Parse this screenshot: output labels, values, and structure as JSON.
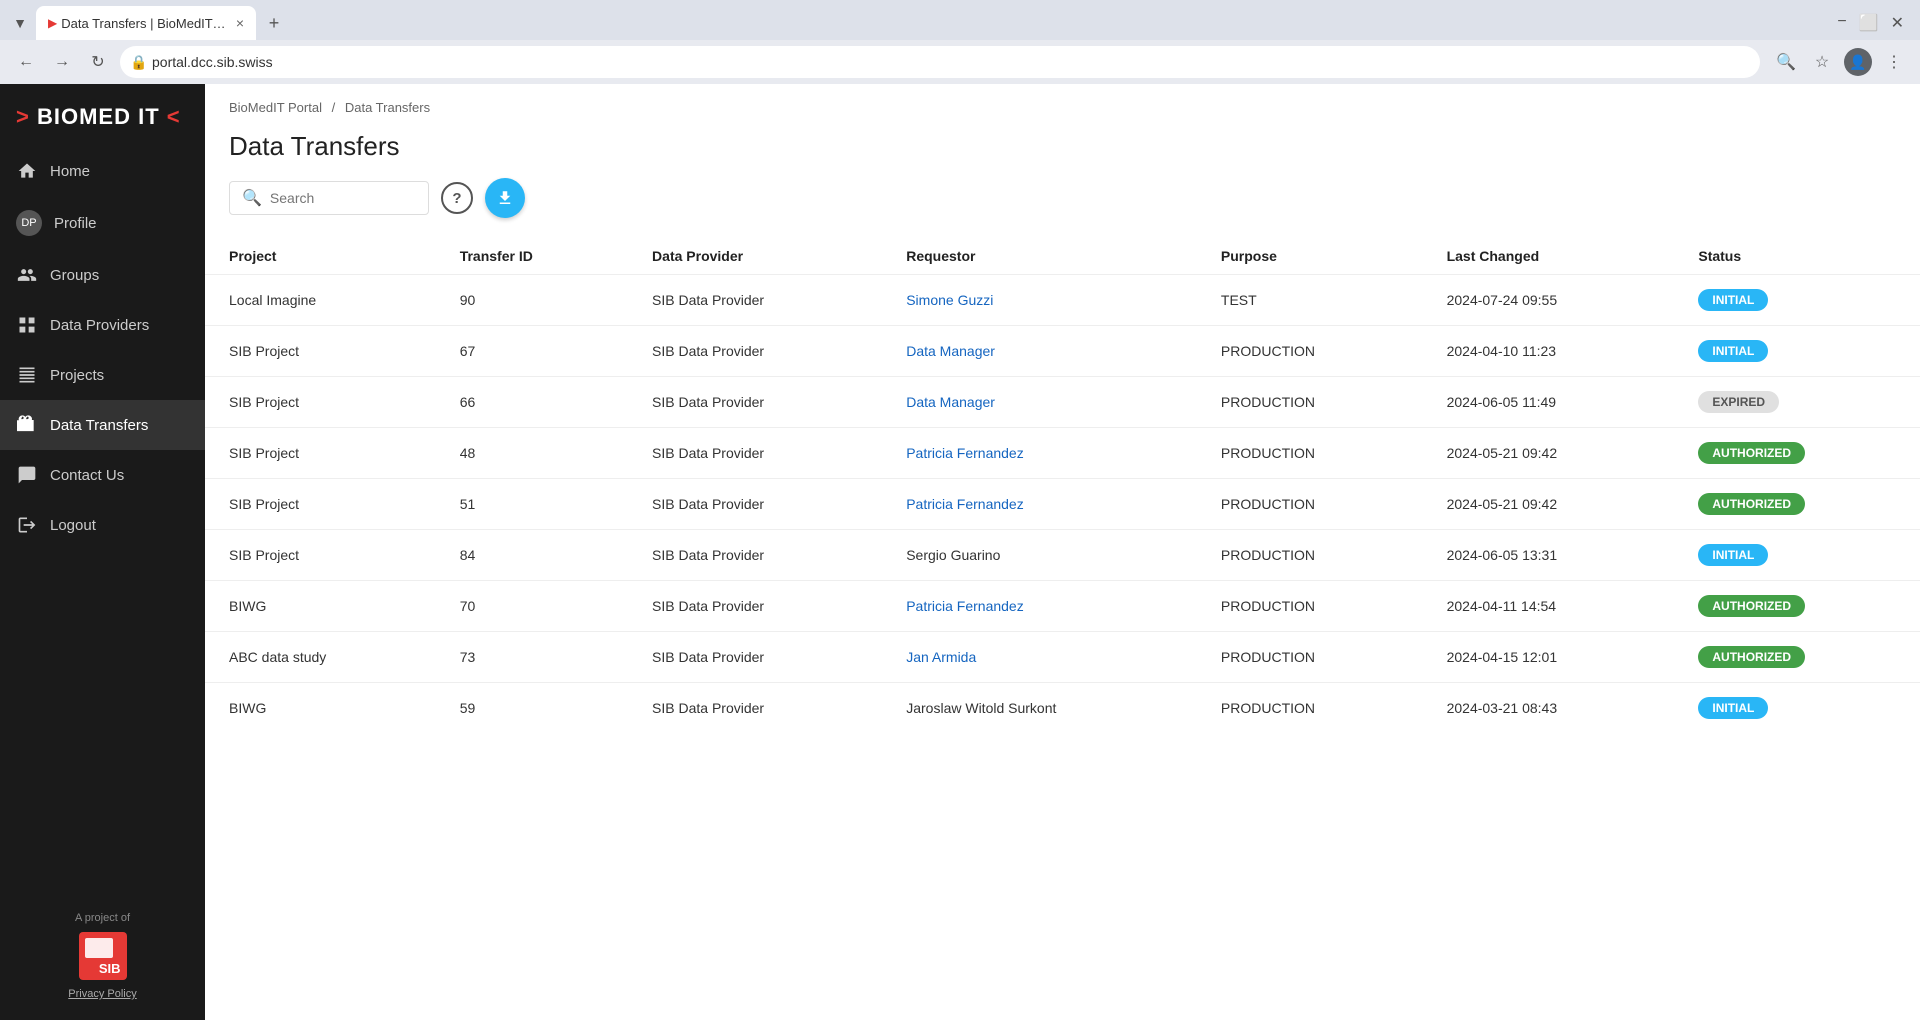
{
  "browser": {
    "tab_title": "Data Transfers | BioMedIT Porta",
    "url": "portal.dcc.sib.swiss",
    "new_tab_label": "+",
    "close_tab": "×",
    "minimize": "−",
    "maximize": "⬜",
    "close_window": "✕"
  },
  "sidebar": {
    "logo_main": "BIOMED IT",
    "nav_items": [
      {
        "id": "home",
        "label": "Home",
        "icon": "home"
      },
      {
        "id": "profile",
        "label": "Profile",
        "icon": "avatar",
        "avatar_text": "DP"
      },
      {
        "id": "groups",
        "label": "Groups",
        "icon": "people"
      },
      {
        "id": "data-providers",
        "label": "Data Providers",
        "icon": "grid"
      },
      {
        "id": "projects",
        "label": "Projects",
        "icon": "table"
      },
      {
        "id": "data-transfers",
        "label": "Data Transfers",
        "icon": "briefcase",
        "active": true
      },
      {
        "id": "contact-us",
        "label": "Contact Us",
        "icon": "chat"
      },
      {
        "id": "logout",
        "label": "Logout",
        "icon": "logout"
      }
    ],
    "footer_text": "A project of",
    "sib_logo_text": "SIB",
    "privacy_link": "Privacy Policy"
  },
  "breadcrumb": {
    "home_label": "BioMedIT Portal",
    "separator": "/",
    "current": "Data Transfers"
  },
  "page": {
    "title": "Data Transfers",
    "search_placeholder": "Search"
  },
  "table": {
    "columns": [
      "Project",
      "Transfer ID",
      "Data Provider",
      "Requestor",
      "Purpose",
      "Last Changed",
      "Status"
    ],
    "rows": [
      {
        "project": "Local Imagine",
        "transfer_id": "90",
        "data_provider": "SIB Data Provider",
        "requestor": "Simone Guzzi",
        "requestor_link": true,
        "purpose": "TEST",
        "last_changed": "2024-07-24 09:55",
        "status": "INITIAL",
        "status_type": "initial"
      },
      {
        "project": "SIB Project",
        "transfer_id": "67",
        "data_provider": "SIB Data Provider",
        "requestor": "Data Manager",
        "requestor_link": true,
        "purpose": "PRODUCTION",
        "last_changed": "2024-04-10 11:23",
        "status": "INITIAL",
        "status_type": "initial"
      },
      {
        "project": "SIB Project",
        "transfer_id": "66",
        "data_provider": "SIB Data Provider",
        "requestor": "Data Manager",
        "requestor_link": true,
        "purpose": "PRODUCTION",
        "last_changed": "2024-06-05 11:49",
        "status": "EXPIRED",
        "status_type": "expired"
      },
      {
        "project": "SIB Project",
        "transfer_id": "48",
        "data_provider": "SIB Data Provider",
        "requestor": "Patricia Fernandez",
        "requestor_link": true,
        "purpose": "PRODUCTION",
        "last_changed": "2024-05-21 09:42",
        "status": "AUTHORIZED",
        "status_type": "authorized"
      },
      {
        "project": "SIB Project",
        "transfer_id": "51",
        "data_provider": "SIB Data Provider",
        "requestor": "Patricia Fernandez",
        "requestor_link": true,
        "purpose": "PRODUCTION",
        "last_changed": "2024-05-21 09:42",
        "status": "AUTHORIZED",
        "status_type": "authorized"
      },
      {
        "project": "SIB Project",
        "transfer_id": "84",
        "data_provider": "SIB Data Provider",
        "requestor": "Sergio Guarino",
        "requestor_link": false,
        "purpose": "PRODUCTION",
        "last_changed": "2024-06-05 13:31",
        "status": "INITIAL",
        "status_type": "initial"
      },
      {
        "project": "BIWG",
        "transfer_id": "70",
        "data_provider": "SIB Data Provider",
        "requestor": "Patricia Fernandez",
        "requestor_link": true,
        "purpose": "PRODUCTION",
        "last_changed": "2024-04-11 14:54",
        "status": "AUTHORIZED",
        "status_type": "authorized"
      },
      {
        "project": "ABC data study",
        "transfer_id": "73",
        "data_provider": "SIB Data Provider",
        "requestor": "Jan Armida",
        "requestor_link": true,
        "purpose": "PRODUCTION",
        "last_changed": "2024-04-15 12:01",
        "status": "AUTHORIZED",
        "status_type": "authorized"
      },
      {
        "project": "BIWG",
        "transfer_id": "59",
        "data_provider": "SIB Data Provider",
        "requestor": "Jaroslaw Witold Surkont",
        "requestor_link": false,
        "purpose": "PRODUCTION",
        "last_changed": "2024-03-21 08:43",
        "status": "INITIAL",
        "status_type": "initial"
      }
    ]
  }
}
